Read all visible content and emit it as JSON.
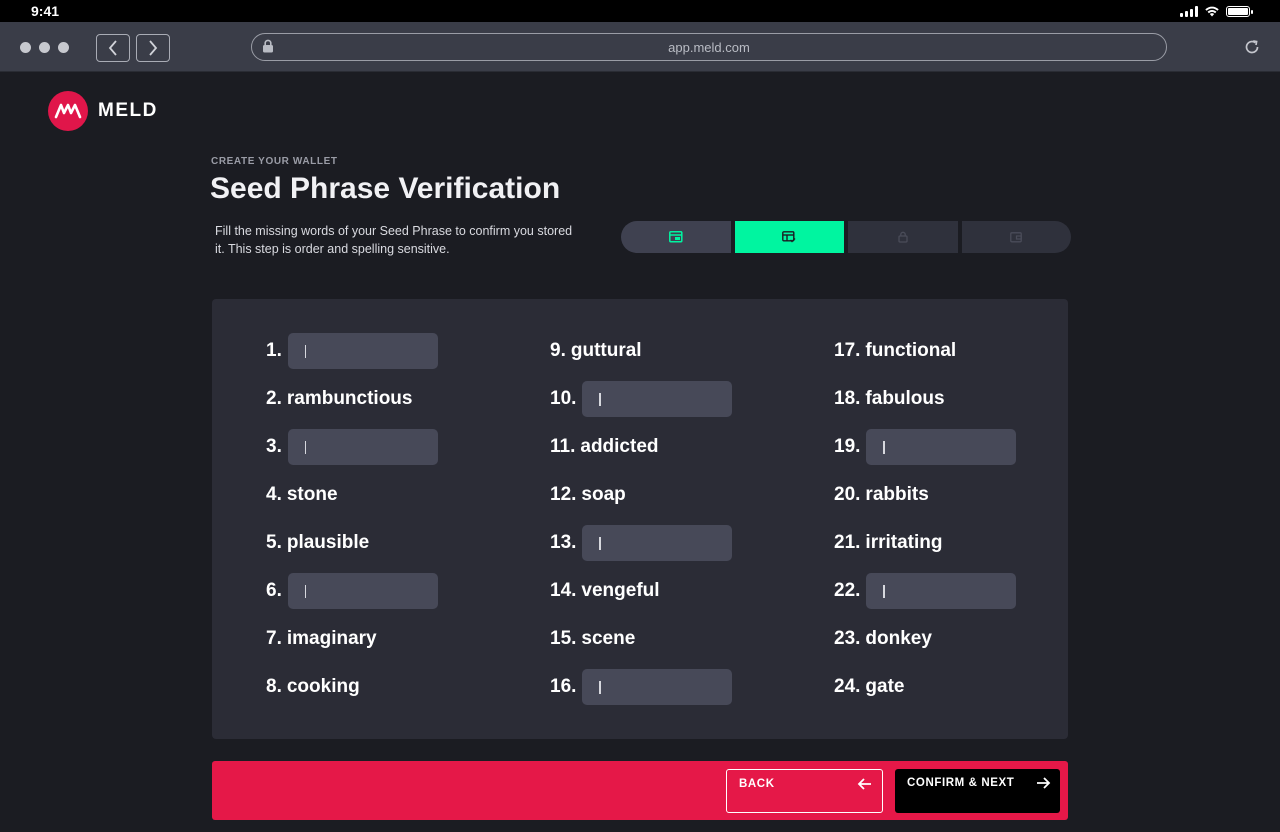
{
  "status_bar": {
    "time": "9:41"
  },
  "browser": {
    "url": "app.meld.com"
  },
  "brand": {
    "name": "MELD",
    "accent": "#e0164a"
  },
  "header": {
    "eyebrow": "CREATE YOUR WALLET",
    "title": "Seed Phrase Verification",
    "description": "Fill the missing words of your Seed Phrase to confirm you stored it. This step is order and spelling sensitive."
  },
  "stepper": {
    "steps": [
      {
        "icon": "wallet-grid-icon",
        "state": "done"
      },
      {
        "icon": "checklist-icon",
        "state": "active"
      },
      {
        "icon": "lock-icon",
        "state": "upcoming"
      },
      {
        "icon": "wallet-icon",
        "state": "upcoming"
      }
    ],
    "active_color": "#00f5a0"
  },
  "words": [
    {
      "n": "1.",
      "word": "",
      "blank": true
    },
    {
      "n": "2.",
      "word": "rambunctious",
      "blank": false
    },
    {
      "n": "3.",
      "word": "",
      "blank": true
    },
    {
      "n": "4.",
      "word": "stone",
      "blank": false
    },
    {
      "n": "5.",
      "word": "plausible",
      "blank": false
    },
    {
      "n": "6.",
      "word": "",
      "blank": true
    },
    {
      "n": "7.",
      "word": "imaginary",
      "blank": false
    },
    {
      "n": "8.",
      "word": "cooking",
      "blank": false
    },
    {
      "n": "9.",
      "word": "guttural",
      "blank": false
    },
    {
      "n": "10.",
      "word": "",
      "blank": true
    },
    {
      "n": "11.",
      "word": "addicted",
      "blank": false
    },
    {
      "n": "12.",
      "word": "soap",
      "blank": false
    },
    {
      "n": "13.",
      "word": "",
      "blank": true
    },
    {
      "n": "14.",
      "word": "vengeful",
      "blank": false
    },
    {
      "n": "15.",
      "word": "scene",
      "blank": false
    },
    {
      "n": "16.",
      "word": "",
      "blank": true
    },
    {
      "n": "17.",
      "word": "functional",
      "blank": false
    },
    {
      "n": "18.",
      "word": "fabulous",
      "blank": false
    },
    {
      "n": "19.",
      "word": "",
      "blank": true
    },
    {
      "n": "20.",
      "word": "rabbits",
      "blank": false
    },
    {
      "n": "21.",
      "word": "irritating",
      "blank": false
    },
    {
      "n": "22.",
      "word": "",
      "blank": true
    },
    {
      "n": "23.",
      "word": "donkey",
      "blank": false
    },
    {
      "n": "24.",
      "word": "gate",
      "blank": false
    }
  ],
  "footer": {
    "back_label": "BACK",
    "next_label": "CONFIRM & NEXT",
    "color": "#e51848"
  }
}
